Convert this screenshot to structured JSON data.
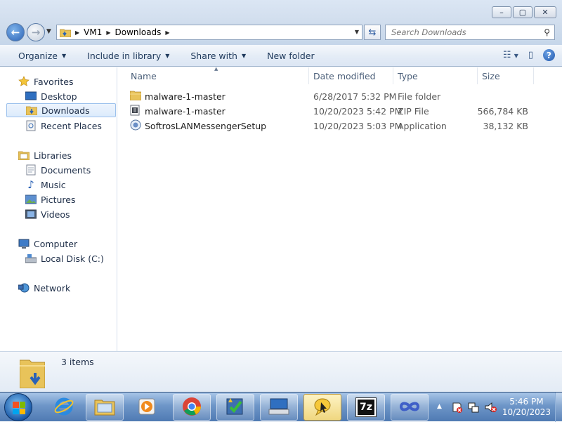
{
  "window": {
    "caption_buttons": {
      "minimize": "–",
      "maximize": "▢",
      "close": "✕"
    },
    "address": {
      "crumbs": [
        "VM1",
        "Downloads"
      ]
    },
    "search": {
      "placeholder": "Search Downloads"
    },
    "toolbar": {
      "organize": "Organize",
      "include_in_library": "Include in library",
      "share_with": "Share with",
      "new_folder": "New folder"
    }
  },
  "nav": {
    "favorites": {
      "label": "Favorites",
      "items": [
        "Desktop",
        "Downloads",
        "Recent Places"
      ]
    },
    "libraries": {
      "label": "Libraries",
      "items": [
        "Documents",
        "Music",
        "Pictures",
        "Videos"
      ]
    },
    "computer": {
      "label": "Computer",
      "items": [
        "Local Disk (C:)"
      ]
    },
    "network": {
      "label": "Network"
    }
  },
  "columns": {
    "name": "Name",
    "date": "Date modified",
    "type": "Type",
    "size": "Size"
  },
  "files": [
    {
      "name": "malware-1-master",
      "date": "6/28/2017 5:32 PM",
      "type": "File folder",
      "size": "",
      "icon": "folder-icon"
    },
    {
      "name": "malware-1-master",
      "date": "10/20/2023 5:42 PM",
      "type": "ZIP File",
      "size": "566,784 KB",
      "icon": "zip-file-icon"
    },
    {
      "name": "SoftrosLANMessengerSetup",
      "date": "10/20/2023 5:03 PM",
      "type": "Application",
      "size": "38,132 KB",
      "icon": "installer-icon"
    }
  ],
  "details": {
    "item_count": "3 items"
  },
  "taskbar": {
    "apps": [
      "internet-explorer-icon",
      "file-explorer-icon",
      "media-player-icon",
      "chrome-icon",
      "task-checklist-icon",
      "keyboard-app-icon",
      "messenger-app-icon",
      "7zip-icon",
      "infinity-app-icon"
    ],
    "active_app": "messenger-app-icon",
    "sevenzip_label": "7z",
    "clock": {
      "time": "5:46 PM",
      "date": "10/20/2023"
    }
  },
  "colors": {
    "accent": "#1e395b",
    "selection": "#dcebfc",
    "taskbar": "#4f7ab3"
  }
}
